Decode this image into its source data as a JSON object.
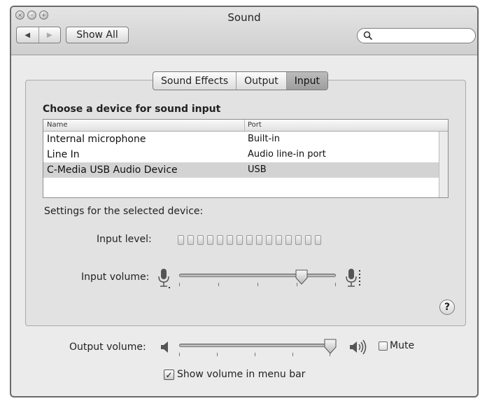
{
  "window": {
    "title": "Sound"
  },
  "toolbar": {
    "show_all_label": "Show All",
    "back_icon": "back-arrow-icon",
    "forward_icon": "forward-arrow-icon",
    "search_placeholder": ""
  },
  "tabs": [
    {
      "label": "Sound Effects",
      "selected": false
    },
    {
      "label": "Output",
      "selected": false
    },
    {
      "label": "Input",
      "selected": true
    }
  ],
  "device_section": {
    "title": "Choose a device for sound input",
    "columns": [
      "Name",
      "Port"
    ],
    "rows": [
      {
        "name": "Internal microphone",
        "port": "Built-in",
        "selected": false
      },
      {
        "name": "Line In",
        "port": "Audio line-in port",
        "selected": false
      },
      {
        "name": "C-Media USB Audio Device",
        "port": "USB",
        "selected": true
      }
    ]
  },
  "settings": {
    "label": "Settings for the selected device:",
    "input_level_label": "Input level:",
    "input_level_segments": 15,
    "input_level_active": 0,
    "input_volume_label": "Input volume:",
    "input_volume_fraction": 0.78
  },
  "output": {
    "volume_label": "Output volume:",
    "volume_fraction": 1.0,
    "mute_label": "Mute",
    "mute_checked": false,
    "show_volume_label": "Show volume in menu bar",
    "show_volume_checked": true
  },
  "help_label": "?",
  "colors": {
    "window_bg": "#ebebeb",
    "selected_tab": "#a8a8a8",
    "selected_row": "#d3d3d3"
  }
}
